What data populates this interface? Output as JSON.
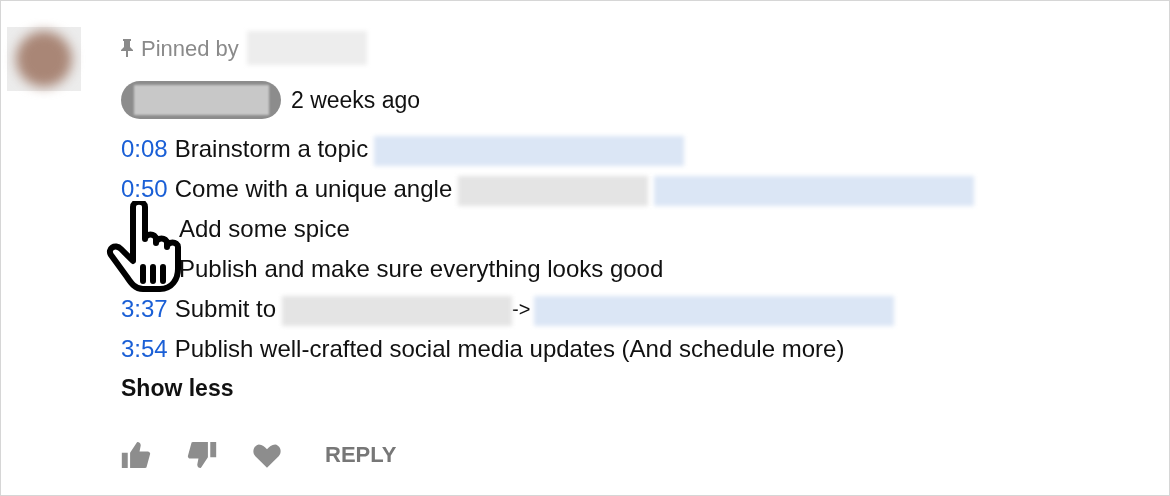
{
  "pinned": {
    "label": "Pinned by"
  },
  "comment": {
    "posted": "2 weeks ago",
    "lines": [
      {
        "time": "0:08",
        "text": "Brainstorm a topic",
        "redactions": [
          {
            "kind": "link"
          }
        ]
      },
      {
        "time": "0:50",
        "text": "Come with a unique angle",
        "redactions": [
          {
            "kind": "text"
          },
          {
            "kind": "link"
          }
        ]
      },
      {
        "text": "Add some spice"
      },
      {
        "text": "Publish and make sure everything looks good"
      },
      {
        "time": "3:37",
        "text": "Submit to",
        "redactions": [
          {
            "kind": "text"
          }
        ],
        "tail": "->",
        "tail_redactions": [
          {
            "kind": "link"
          }
        ]
      },
      {
        "time": "3:54",
        "text": "Publish well-crafted social media updates (And schedule more)"
      }
    ],
    "toggle": "Show less"
  },
  "actions": {
    "reply": "REPLY"
  }
}
